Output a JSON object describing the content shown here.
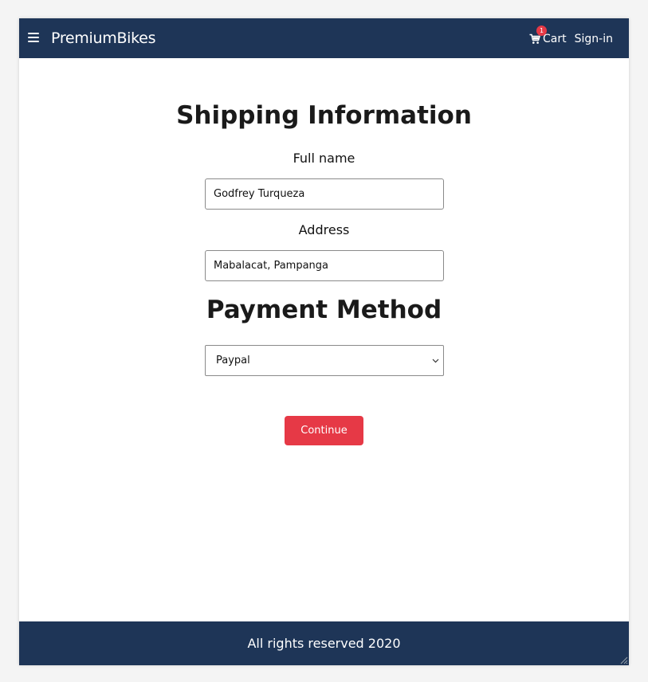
{
  "header": {
    "brand": "PremiumBikes",
    "cart_label": "Cart",
    "cart_count": "1",
    "signin_label": "Sign-in"
  },
  "shipping": {
    "title": "Shipping Information",
    "fullname_label": "Full name",
    "fullname_value": "Godfrey Turqueza",
    "address_label": "Address",
    "address_value": "Mabalacat, Pampanga"
  },
  "payment": {
    "title": "Payment Method",
    "selected_option": "Paypal"
  },
  "actions": {
    "continue_label": "Continue"
  },
  "footer": {
    "text": "All rights reserved 2020"
  },
  "colors": {
    "nav_bg": "#1e3557",
    "accent": "#e63946"
  },
  "icons": {
    "menu": "hamburger-icon",
    "cart": "cart-icon",
    "dropdown": "chevron-down-icon",
    "grip": "resize-grip-icon"
  }
}
